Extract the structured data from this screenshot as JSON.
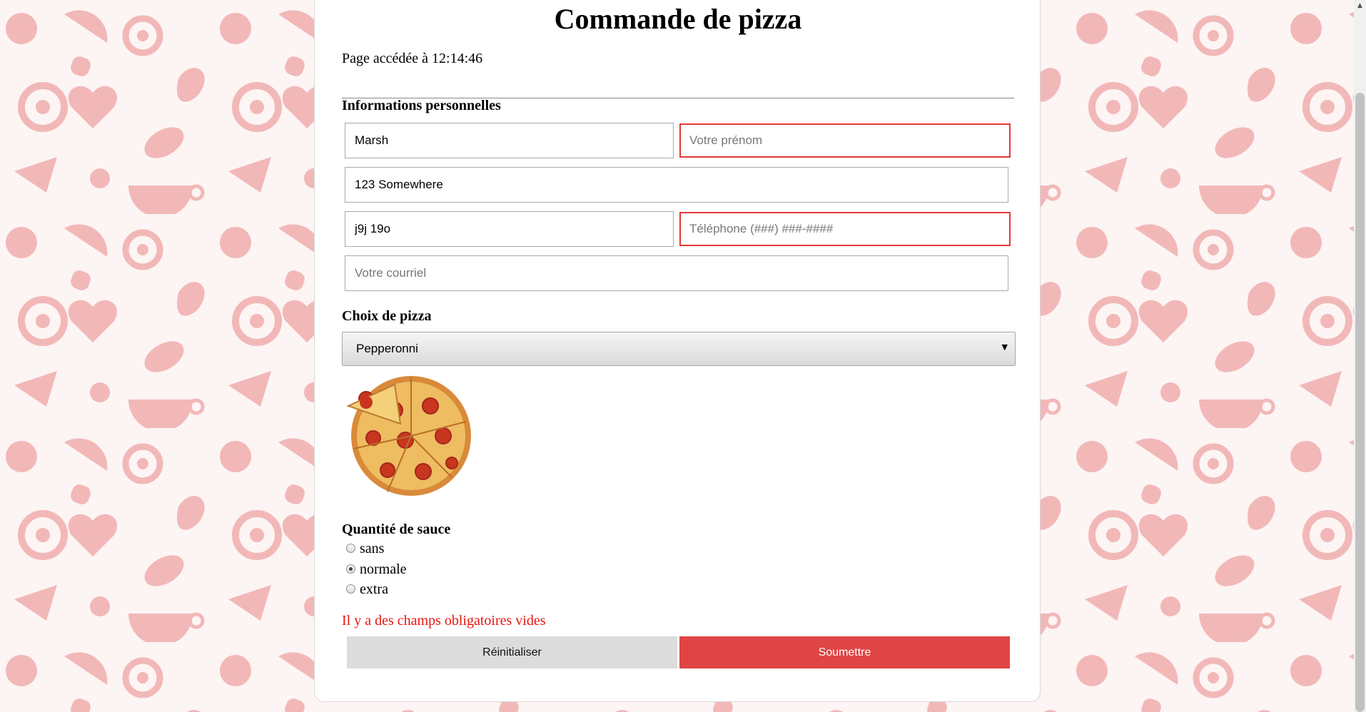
{
  "page": {
    "title": "Commande de pizza",
    "accessed_text": "Page accédée à 12:14:46"
  },
  "personal": {
    "heading": "Informations personnelles",
    "last_name": {
      "value": "Marsh",
      "placeholder": ""
    },
    "first_name": {
      "value": "",
      "placeholder": "Votre prénom"
    },
    "address": {
      "value": "123 Somewhere",
      "placeholder": ""
    },
    "postal_code": {
      "value": "j9j 19o",
      "placeholder": ""
    },
    "phone": {
      "value": "",
      "placeholder": "Téléphone (###) ###-####"
    },
    "email": {
      "value": "",
      "placeholder": "Votre courriel"
    }
  },
  "pizza": {
    "heading": "Choix de pizza",
    "selected": "Pepperonni",
    "image_subject": "pepperoni pizza"
  },
  "sauce": {
    "heading": "Quantité de sauce",
    "options": [
      {
        "label": "sans",
        "checked": false
      },
      {
        "label": "normale",
        "checked": true
      },
      {
        "label": "extra",
        "checked": false
      }
    ]
  },
  "error_message": "Il y a des champs obligatoires vides",
  "buttons": {
    "reset": "Réinitialiser",
    "submit": "Soumettre"
  },
  "colors": {
    "error": "#e8160e",
    "submit_button": "#e04545",
    "reset_button": "#dcdcdc",
    "pattern": "#f2b8b8"
  },
  "icons": {
    "scroll_up": "scroll-up-arrow-icon",
    "dropdown": "chevron-down-icon"
  }
}
